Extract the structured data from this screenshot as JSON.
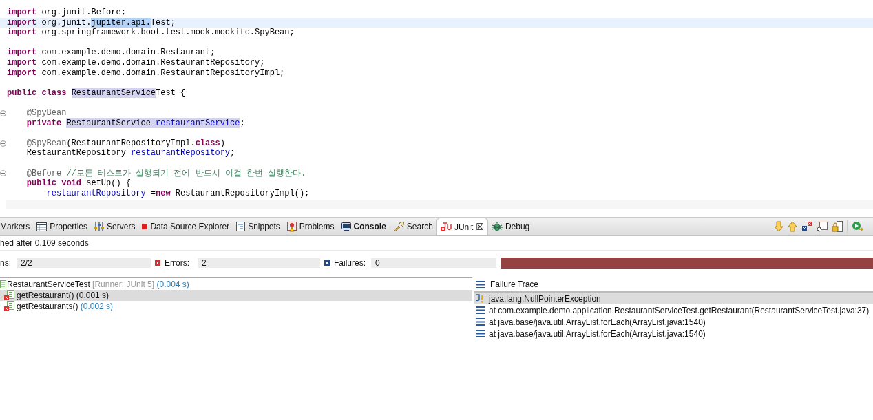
{
  "editor": {
    "lines": [
      {
        "fold": false,
        "current": false,
        "tokens": [
          {
            "kind": "k",
            "text": "import"
          },
          {
            "kind": "p",
            "text": " org.junit.Before;"
          }
        ]
      },
      {
        "fold": false,
        "current": true,
        "tokens": [
          {
            "kind": "k",
            "text": "import"
          },
          {
            "kind": "p",
            "text": " org.junit."
          },
          {
            "kind": "p",
            "text": "jupiter.api.",
            "selected": true
          },
          {
            "kind": "p",
            "text": "Test;"
          }
        ]
      },
      {
        "fold": false,
        "current": false,
        "tokens": [
          {
            "kind": "k",
            "text": "import"
          },
          {
            "kind": "p",
            "text": " org.springframework.boot.test.mock.mockito.SpyBean;"
          }
        ]
      },
      {
        "fold": false,
        "current": false
      },
      {
        "fold": false,
        "current": false,
        "tokens": [
          {
            "kind": "k",
            "text": "import"
          },
          {
            "kind": "p",
            "text": " com.example.demo.domain.Restaurant;"
          }
        ]
      },
      {
        "fold": false,
        "current": false,
        "tokens": [
          {
            "kind": "k",
            "text": "import"
          },
          {
            "kind": "p",
            "text": " com.example.demo.domain.RestaurantRepository;"
          }
        ]
      },
      {
        "fold": false,
        "current": false,
        "tokens": [
          {
            "kind": "k",
            "text": "import"
          },
          {
            "kind": "p",
            "text": " com.example.demo.domain.RestaurantRepositoryImpl;"
          }
        ]
      },
      {
        "fold": false,
        "current": false
      },
      {
        "fold": false,
        "current": false,
        "tokens": [
          {
            "kind": "k",
            "text": "public"
          },
          {
            "kind": "k",
            "text": " class "
          },
          {
            "kind": "p",
            "text": "RestaurantService",
            "highlighted": true
          },
          {
            "kind": "p",
            "text": "Test {"
          }
        ]
      },
      {
        "fold": false,
        "current": false
      },
      {
        "fold": true,
        "current": false,
        "tokens": [
          {
            "kind": "a",
            "text": "    @SpyBean"
          }
        ]
      },
      {
        "fold": false,
        "current": false,
        "tokens": [
          {
            "kind": "k",
            "text": "    private "
          },
          {
            "kind": "p",
            "text": "RestaurantService",
            "highlighted": true
          },
          {
            "kind": "f",
            "text": " restaurantService",
            "highlighted": true
          },
          {
            "kind": "p",
            "text": ";"
          }
        ]
      },
      {
        "fold": false,
        "current": false
      },
      {
        "fold": true,
        "current": false,
        "tokens": [
          {
            "kind": "a",
            "text": "    @SpyBean"
          },
          {
            "kind": "p",
            "text": "(RestaurantRepositoryImpl."
          },
          {
            "kind": "k",
            "text": "class"
          },
          {
            "kind": "p",
            "text": ")"
          }
        ]
      },
      {
        "fold": false,
        "current": false,
        "tokens": [
          {
            "kind": "p",
            "text": "    RestaurantRepository "
          },
          {
            "kind": "f",
            "text": "restaurantRepository"
          },
          {
            "kind": "p",
            "text": ";"
          }
        ]
      },
      {
        "fold": false,
        "current": false
      },
      {
        "fold": true,
        "current": false,
        "tokens": [
          {
            "kind": "a",
            "text": "    @Before"
          },
          {
            "kind": "c",
            "text": " //모든 테스트가 실행되기 전에 반드시 이걸 한번 실행한다."
          }
        ]
      },
      {
        "fold": false,
        "current": false,
        "tokens": [
          {
            "kind": "k",
            "text": "    public"
          },
          {
            "kind": "k",
            "text": " void"
          },
          {
            "kind": "p",
            "text": " setUp() {"
          }
        ]
      },
      {
        "fold": false,
        "current": false,
        "tokens": [
          {
            "kind": "f",
            "text": "        restaurantRepository"
          },
          {
            "kind": "p",
            "text": " ="
          },
          {
            "kind": "k",
            "text": "new"
          },
          {
            "kind": "p",
            "text": " RestaurantRepositoryImpl();"
          }
        ]
      }
    ]
  },
  "tabs": [
    {
      "kind": "markers",
      "label": "Markers",
      "selected": false,
      "bold": false
    },
    {
      "kind": "properties",
      "label": "Properties",
      "selected": false,
      "bold": false
    },
    {
      "kind": "servers",
      "label": "Servers",
      "selected": false,
      "bold": false
    },
    {
      "kind": "datasource",
      "label": "Data Source Explorer",
      "selected": false,
      "bold": false
    },
    {
      "kind": "snippets",
      "label": "Snippets",
      "selected": false,
      "bold": false
    },
    {
      "kind": "problems",
      "label": "Problems",
      "selected": false,
      "bold": false
    },
    {
      "kind": "console",
      "label": "Console",
      "selected": false,
      "bold": true
    },
    {
      "kind": "search",
      "label": "Search",
      "selected": false,
      "bold": false
    },
    {
      "kind": "junit",
      "label": "JUnit",
      "selected": true,
      "bold": false,
      "close": "☒"
    },
    {
      "kind": "debug",
      "label": "Debug",
      "selected": false,
      "bold": false
    }
  ],
  "status": "hed after 0.109 seconds",
  "counters": [
    {
      "kind": "runs",
      "label": "ns:",
      "value": "2/2"
    },
    {
      "kind": "errors",
      "label": "Errors:",
      "value": "2"
    },
    {
      "kind": "failures",
      "label": "Failures:",
      "value": "0"
    }
  ],
  "progress": {
    "level": 1,
    "failed": true
  },
  "tree": {
    "name": "RestaurantServiceTest",
    "runner": "[Runner: JUnit 5]",
    "time": "(0.004 s)",
    "selected": false,
    "children": [
      {
        "name": "getRestaurant()",
        "time": "(0.001 s)",
        "selected": true
      },
      {
        "name": "getRestaurants()",
        "time": "(0.002 s)",
        "selected": false
      }
    ]
  },
  "trace": {
    "title": "Failure Trace",
    "rows": [
      {
        "kind": "exception",
        "text": "java.lang.NullPointerException",
        "selected": true
      },
      {
        "kind": "frame",
        "text": "at com.example.demo.application.RestaurantServiceTest.getRestaurant(RestaurantServiceTest.java:37)",
        "selected": false
      },
      {
        "kind": "frame",
        "text": "at java.base/java.util.ArrayList.forEach(ArrayList.java:1540)",
        "selected": false
      },
      {
        "kind": "frame",
        "text": "at java.base/java.util.ArrayList.forEach(ArrayList.java:1540)",
        "selected": false
      }
    ]
  }
}
